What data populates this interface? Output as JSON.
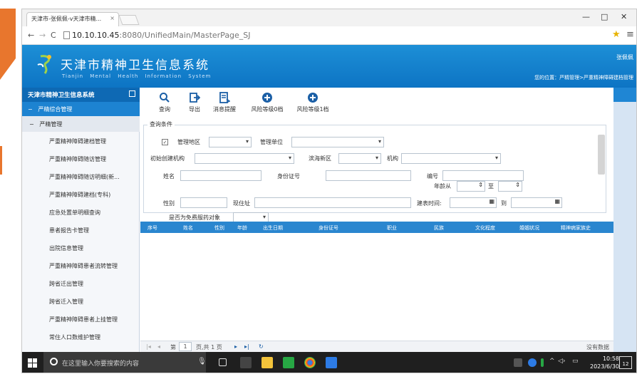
{
  "browser": {
    "tab_title": "天津市-张佩佩-v天津市精...",
    "url_host": "10.10.10.45",
    "url_rest": ":8080/UnifiedMain/MasterPage_SJ",
    "window_controls": [
      "—",
      "□",
      "✕"
    ]
  },
  "app": {
    "title_cn": "天津市精神卫生信息系统",
    "title_en": "Tianjin  Mental  Health  Information  System",
    "user": "张佩佩",
    "breadcrumb": "您的位置：严精管理>严重精神障碍建档管理"
  },
  "sidebar": {
    "header": "天津市精神卫生信息系统",
    "group": "严精综合管理",
    "group_toggle": "−",
    "subgroup": "严精管理",
    "subgroup_toggle": "−",
    "items": [
      "严重精神障碍建档管理",
      "严重精神障碍随访管理",
      "严重精神障碍随访明细(新...",
      "严重精神障碍建档(专科)",
      "应急处置单明细查询",
      "患者报告卡管理",
      "出院信息管理",
      "严重精神障碍患者流转管理",
      "跨省迁出管理",
      "跨省迁入管理",
      "严重精神障碍患者上挂管理",
      "常住人口数维护管理"
    ]
  },
  "toolbar": {
    "search_label": "查询",
    "export_label": "导出",
    "notify_label": "消息提醒",
    "risk0_label": "风险等级0档",
    "risk1_label": "风险等级1档"
  },
  "query": {
    "section_title": "查询条件",
    "region_label": "管理地区",
    "unit_label": "管理单位",
    "origin_org_label": "初始创建机构",
    "binhai_label": "滨海新区",
    "org_label": "机构",
    "name_label": "姓名",
    "idcard_label": "身份证号",
    "number_label": "编号",
    "age_from_label": "年龄从",
    "age_to_label": "至",
    "gender_label": "性别",
    "address_label": "现住址",
    "created_label": "建表时间:",
    "date_to_label": "到",
    "free_med_label": "是否为免费服药对象"
  },
  "grid": {
    "columns": [
      "序号",
      "姓名",
      "性别",
      "年龄",
      "出生日期",
      "身份证号",
      "职业",
      "民族",
      "文化程度",
      "婚姻状况",
      "精神病家族史"
    ]
  },
  "pager": {
    "first": "|◂",
    "prev": "◂",
    "page_label": "第",
    "page_value": "1",
    "total_label": "页,共 1 页",
    "next": "▸",
    "last": "▸|",
    "refresh": "↻",
    "empty_text": "没有数据"
  },
  "taskbar": {
    "search_placeholder": "在这里输入你要搜索的内容",
    "time": "10:58",
    "date": "2023/6/30",
    "tray_badge": "12"
  },
  "colors": {
    "header_blue": "#0d74c4",
    "sidebar_head": "#0e69b4",
    "grid_head": "#2a86cf",
    "accent_orange": "#e8762d"
  }
}
